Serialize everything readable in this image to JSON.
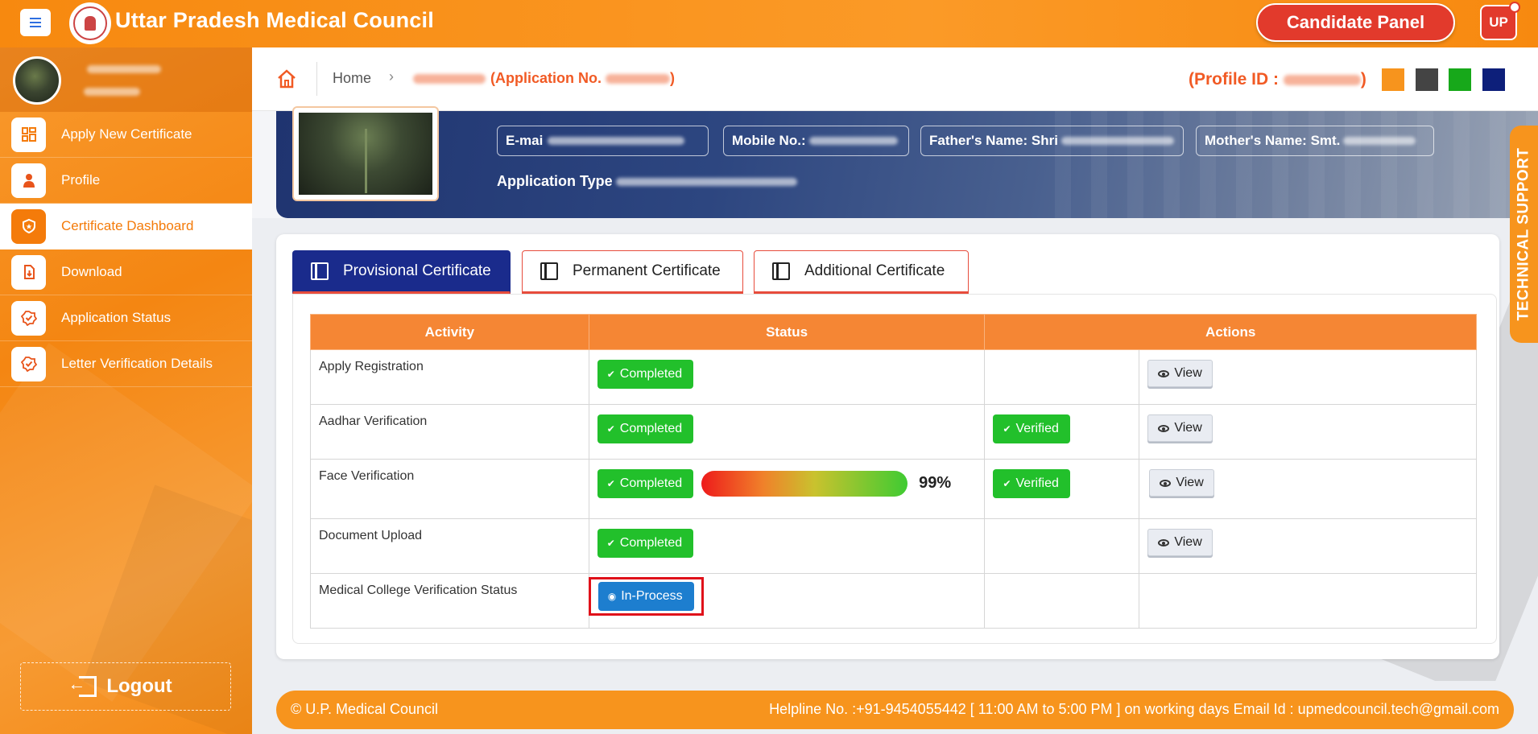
{
  "header": {
    "title": "Uttar Pradesh Medical Council",
    "candidate_panel_label": "Candidate Panel",
    "user_badge": "UP"
  },
  "sidebar": {
    "items": [
      {
        "label": "Apply New Certificate",
        "icon": "grid-icon"
      },
      {
        "label": "Profile",
        "icon": "user-icon"
      },
      {
        "label": "Certificate Dashboard",
        "icon": "shield-icon",
        "active": true
      },
      {
        "label": "Download",
        "icon": "download-icon"
      },
      {
        "label": "Application Status",
        "icon": "check-badge-icon"
      },
      {
        "label": "Letter Verification Details",
        "icon": "check-badge-icon"
      }
    ],
    "logout_label": "Logout"
  },
  "breadcrumb": {
    "home": "Home",
    "app_prefix": "(Application No.",
    "app_suffix": ")",
    "profile_id_prefix": "(Profile ID :",
    "profile_id_suffix": ")"
  },
  "theme_swatches": [
    "#f7941d",
    "#444444",
    "#17a81a",
    "#0d1f7a"
  ],
  "profile_banner": {
    "email_label": "E-mai",
    "mobile_label": "Mobile No.:",
    "father_label": "Father's Name: Shri",
    "mother_label": "Mother's Name: Smt.",
    "application_type_label": "Application Type"
  },
  "tech_support_label": "TECHNICAL SUPPORT",
  "tabs": [
    {
      "label": "Provisional Certificate",
      "active": true
    },
    {
      "label": "Permanent Certificate"
    },
    {
      "label": "Additional Certificate"
    }
  ],
  "table": {
    "headers": [
      "Activity",
      "Status",
      "Actions"
    ],
    "rows": [
      {
        "activity": "Apply Registration",
        "status": "Completed",
        "verified": "",
        "action": "View"
      },
      {
        "activity": "Aadhar Verification",
        "status": "Completed",
        "verified": "Verified",
        "action": "View"
      },
      {
        "activity": "Face Verification",
        "status": "Completed",
        "match_percent": "99%",
        "verified": "Verified",
        "action": "View"
      },
      {
        "activity": "Document Upload",
        "status": "Completed",
        "verified": "",
        "action": "View"
      },
      {
        "activity": "Medical College Verification Status",
        "status": "In-Process",
        "verified": "",
        "action": ""
      }
    ]
  },
  "footer": {
    "copyright": "© U.P. Medical Council",
    "helpline": "Helpline No. :+91-9454055442 [ 11:00 AM to 5:00 PM ] on working days  Email Id : upmedcouncil.tech@gmail.com"
  }
}
